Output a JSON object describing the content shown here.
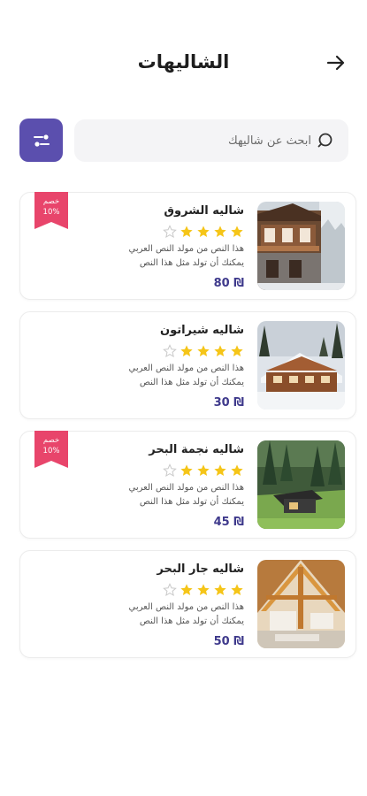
{
  "header": {
    "title": "الشاليهات",
    "back_icon": "arrow-right-icon"
  },
  "search": {
    "placeholder": "ابحث عن شاليهك",
    "icon": "search-icon",
    "filter_icon": "filter-icon"
  },
  "colors": {
    "accent": "#5b4fae",
    "star": "#f5c518",
    "badge": "#e8456b",
    "price": "#3f3a8c"
  },
  "chalets": [
    {
      "title": "شاليه الشروق",
      "rating": 4,
      "max_rating": 5,
      "desc_line1": "هذا النص من مولد النص العربي",
      "desc_line2": "يمكنك أن تولد مثل هذا النص",
      "price": "₪ 80",
      "badge": true,
      "badge_line1": "خصم",
      "badge_line2": "10%"
    },
    {
      "title": "شاليه شيراتون",
      "rating": 4,
      "max_rating": 5,
      "desc_line1": "هذا النص من مولد النص العربي",
      "desc_line2": "يمكنك أن تولد مثل هذا النص",
      "price": "₪ 30",
      "badge": false
    },
    {
      "title": "شاليه نجمة البحر",
      "rating": 4,
      "max_rating": 5,
      "desc_line1": "هذا النص من مولد النص العربي",
      "desc_line2": "يمكنك أن تولد مثل هذا النص",
      "price": "₪ 45",
      "badge": true,
      "badge_line1": "خصم",
      "badge_line2": "10%"
    },
    {
      "title": "شاليه جار البحر",
      "rating": 4,
      "max_rating": 5,
      "desc_line1": "هذا النص من مولد النص العربي",
      "desc_line2": "يمكنك أن تولد مثل هذا النص",
      "price": "₪ 50",
      "badge": false
    }
  ]
}
